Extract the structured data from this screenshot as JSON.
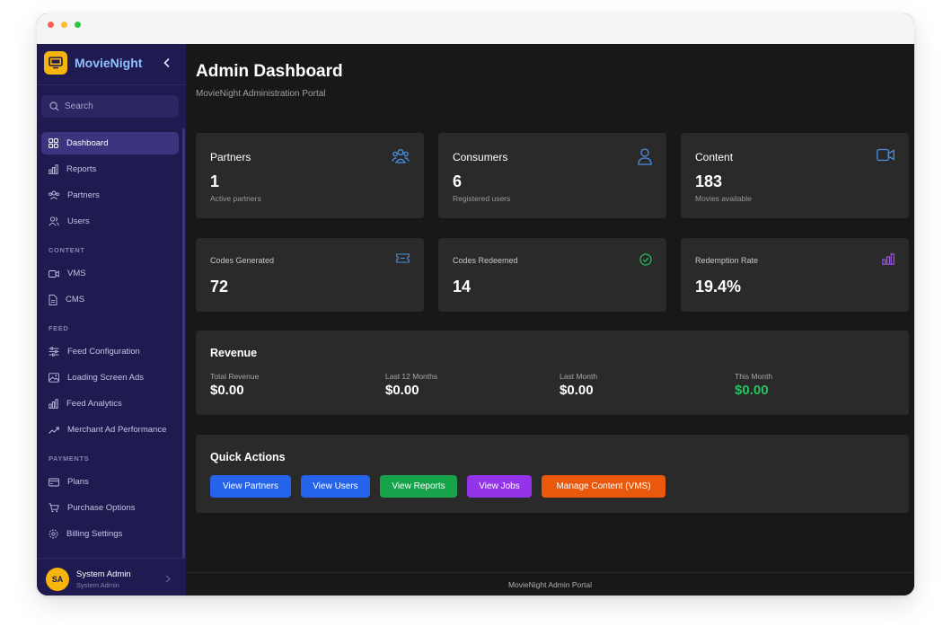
{
  "app": {
    "name": "MovieNight"
  },
  "sidebar": {
    "search_placeholder": "Search",
    "items": [
      {
        "label": "Dashboard",
        "icon": "grid-icon",
        "active": true
      },
      {
        "label": "Reports",
        "icon": "bar-chart-icon"
      },
      {
        "label": "Partners",
        "icon": "users-icon"
      },
      {
        "label": "Users",
        "icon": "user-group-icon"
      }
    ],
    "sections": {
      "content": "CONTENT",
      "feed": "FEED",
      "payments": "PAYMENTS"
    },
    "content_items": [
      {
        "label": "VMS",
        "icon": "video-icon"
      },
      {
        "label": "CMS",
        "icon": "document-icon"
      }
    ],
    "feed_items": [
      {
        "label": "Feed Configuration",
        "icon": "sliders-icon"
      },
      {
        "label": "Loading Screen Ads",
        "icon": "image-icon"
      },
      {
        "label": "Feed Analytics",
        "icon": "bar-chart-icon"
      },
      {
        "label": "Merchant Ad Performance",
        "icon": "trend-icon"
      }
    ],
    "payment_items": [
      {
        "label": "Plans",
        "icon": "card-icon"
      },
      {
        "label": "Purchase Options",
        "icon": "cart-icon"
      },
      {
        "label": "Billing Settings",
        "icon": "gear-icon"
      }
    ],
    "user": {
      "initials": "SA",
      "name": "System Admin",
      "role": "System Admin"
    }
  },
  "header": {
    "title": "Admin Dashboard",
    "subtitle": "MovieNight Administration Portal"
  },
  "stats": [
    {
      "title": "Partners",
      "value": "1",
      "sub": "Active partners",
      "icon": "users-icon"
    },
    {
      "title": "Consumers",
      "value": "6",
      "sub": "Registered users",
      "icon": "user-icon"
    },
    {
      "title": "Content",
      "value": "183",
      "sub": "Movies available",
      "icon": "video-icon"
    }
  ],
  "codes": [
    {
      "title": "Codes Generated",
      "value": "72",
      "icon": "ticket-icon"
    },
    {
      "title": "Codes Redeemed",
      "value": "14",
      "icon": "check-circle-icon"
    },
    {
      "title": "Redemption Rate",
      "value": "19.4%",
      "icon": "bar-chart-icon"
    }
  ],
  "revenue": {
    "title": "Revenue",
    "columns": [
      {
        "label": "Total Revenue",
        "value": "$0.00"
      },
      {
        "label": "Last 12 Months",
        "value": "$0.00"
      },
      {
        "label": "Last Month",
        "value": "$0.00"
      },
      {
        "label": "This Month",
        "value": "$0.00"
      }
    ]
  },
  "quick_actions": {
    "title": "Quick Actions",
    "buttons": [
      {
        "label": "View Partners",
        "color": "#2563eb"
      },
      {
        "label": "View Users",
        "color": "#2563eb"
      },
      {
        "label": "View Reports",
        "color": "#16a34a"
      },
      {
        "label": "View Jobs",
        "color": "#9333ea"
      },
      {
        "label": "Manage Content (VMS)",
        "color": "#ea580c"
      }
    ]
  },
  "footer": {
    "text": "MovieNight Admin Portal"
  },
  "colors": {
    "sidebar_bg": "#1f1a50",
    "accent_blue": "#8ec0ff",
    "brand_yellow": "#f5b50a",
    "positive_green": "#22c55e"
  }
}
